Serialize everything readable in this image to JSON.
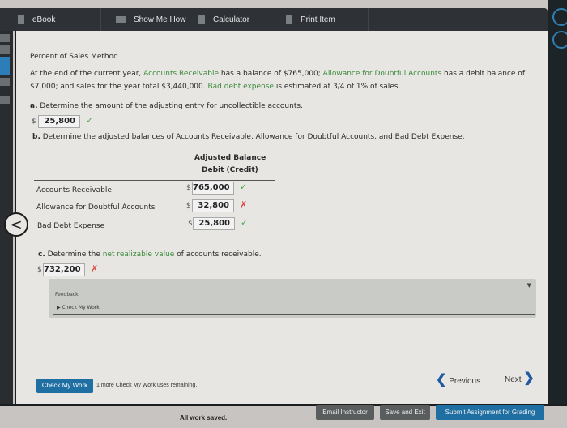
{
  "toolbar": {
    "tabs": [
      {
        "label": "eBook",
        "icon": "book-icon"
      },
      {
        "label": "Show Me How",
        "icon": "video-icon"
      },
      {
        "label": "Calculator",
        "icon": "calculator-icon"
      },
      {
        "label": "Print Item",
        "icon": "print-icon"
      }
    ]
  },
  "problem": {
    "title": "Percent of Sales Method",
    "intro_1": "At the end of the current year, ",
    "intro_link_1": "Accounts Receivable",
    "intro_2": " has a balance of $765,000; ",
    "intro_link_2": "Allowance for Doubtful Accounts",
    "intro_3": " has a debit balance of",
    "intro_4": "$7,000; and sales for the year total $3,440,000. ",
    "intro_link_3": "Bad debt expense",
    "intro_5": " is estimated at 3/4 of 1% of sales."
  },
  "part_a": {
    "letter": "a.",
    "question": "Determine the amount of the adjusting entry for uncollectible accounts.",
    "currency": "$",
    "answer": "25,800",
    "status": "correct"
  },
  "part_b": {
    "letter": "b.",
    "question": "Determine the adjusted balances of Accounts Receivable, Allowance for Doubtful Accounts, and Bad Debt Expense.",
    "header_1": "Adjusted Balance",
    "header_2": "Debit (Credit)",
    "rows": [
      {
        "label": "Accounts Receivable",
        "currency": "$",
        "value": "765,000",
        "status": "correct"
      },
      {
        "label": "Allowance for Doubtful Accounts",
        "currency": "$",
        "value": "32,800",
        "status": "incorrect"
      },
      {
        "label": "Bad Debt Expense",
        "currency": "$",
        "value": "25,800",
        "status": "correct"
      }
    ]
  },
  "part_c": {
    "letter": "c.",
    "q_1": "Determine the ",
    "q_link": "net realizable value",
    "q_2": " of accounts receivable.",
    "currency": "$",
    "answer": "732,200",
    "status": "incorrect"
  },
  "feedback": {
    "title": "Feedback",
    "toggle": "Check My Work"
  },
  "status_marks": {
    "correct": "✓",
    "incorrect": "✗"
  },
  "actions": {
    "check_my_work": "Check My Work",
    "remaining": "1 more Check My Work uses remaining.",
    "previous": "Previous",
    "next": "Next"
  },
  "footer": {
    "saved": "All work saved.",
    "email": "Email Instructor",
    "save_exit": "Save and Exit",
    "submit": "Submit Assignment for Grading"
  }
}
